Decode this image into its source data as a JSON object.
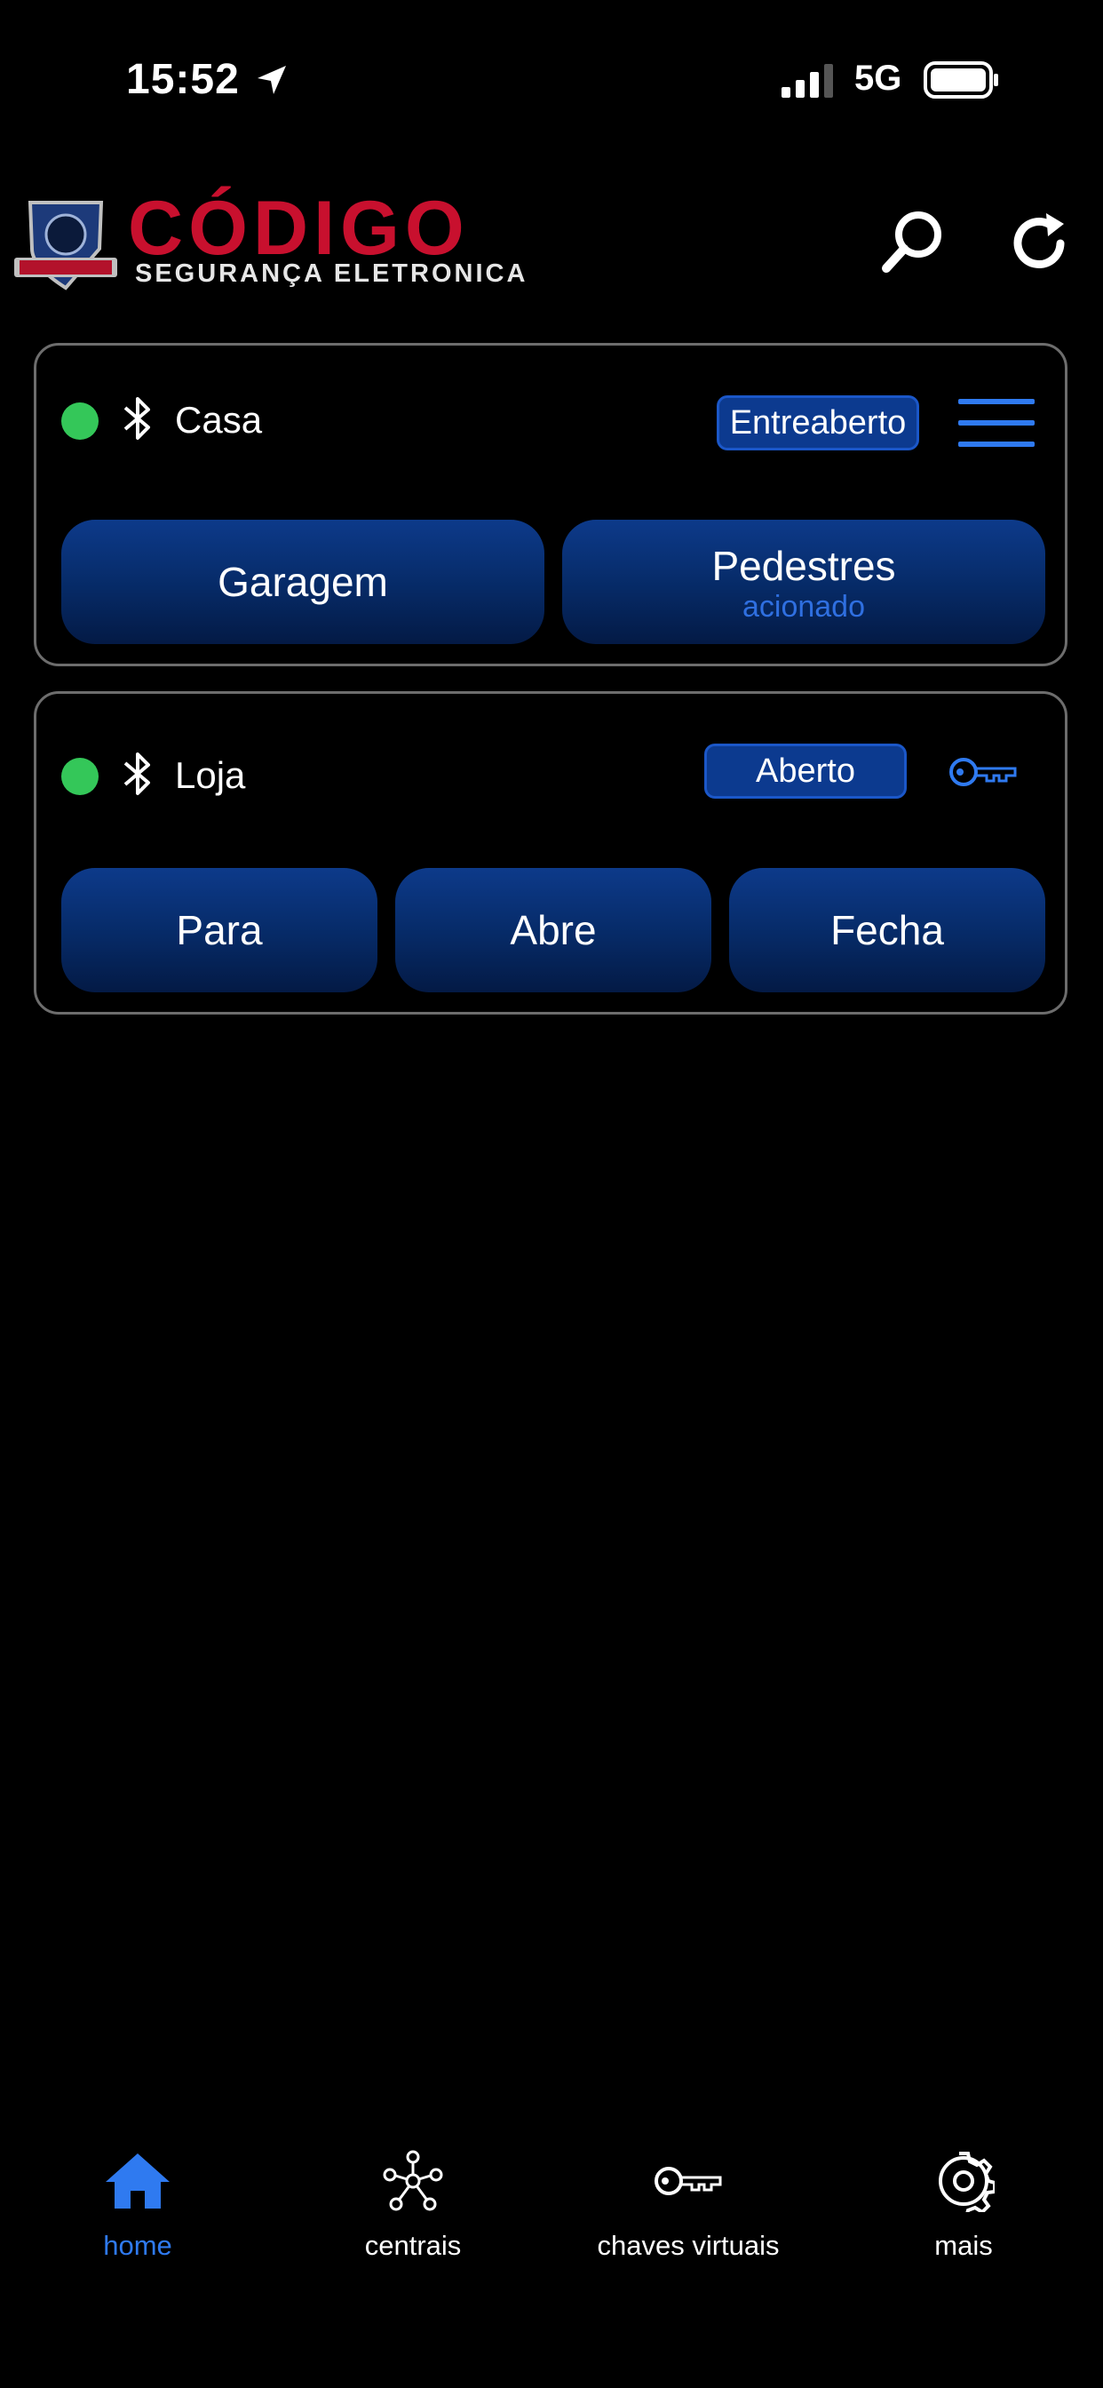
{
  "status_bar": {
    "time": "15:52",
    "network": "5G"
  },
  "header": {
    "logo_title": "CÓDIGO",
    "logo_subtitle": "SEGURANÇA ELETRONICA",
    "logo_badge_text": "CÓDIGO"
  },
  "devices": [
    {
      "name": "Casa",
      "status": "Entreaberto",
      "connected": true,
      "buttons": [
        {
          "label": "Garagem"
        },
        {
          "label": "Pedestres",
          "sublabel": "acionado"
        }
      ]
    },
    {
      "name": "Loja",
      "status": "Aberto",
      "connected": true,
      "buttons": [
        {
          "label": "Para"
        },
        {
          "label": "Abre"
        },
        {
          "label": "Fecha"
        }
      ]
    }
  ],
  "tabs": [
    {
      "label": "home",
      "icon": "home-icon",
      "active": true
    },
    {
      "label": "centrais",
      "icon": "network-icon",
      "active": false
    },
    {
      "label": "chaves virtuais",
      "icon": "key-icon",
      "active": false
    },
    {
      "label": "mais",
      "icon": "gear-icon",
      "active": false
    }
  ],
  "colors": {
    "accent": "#2f7af0",
    "brand_red": "#c8102e",
    "online": "#34c759",
    "button_blue": "#0d3a8a"
  }
}
